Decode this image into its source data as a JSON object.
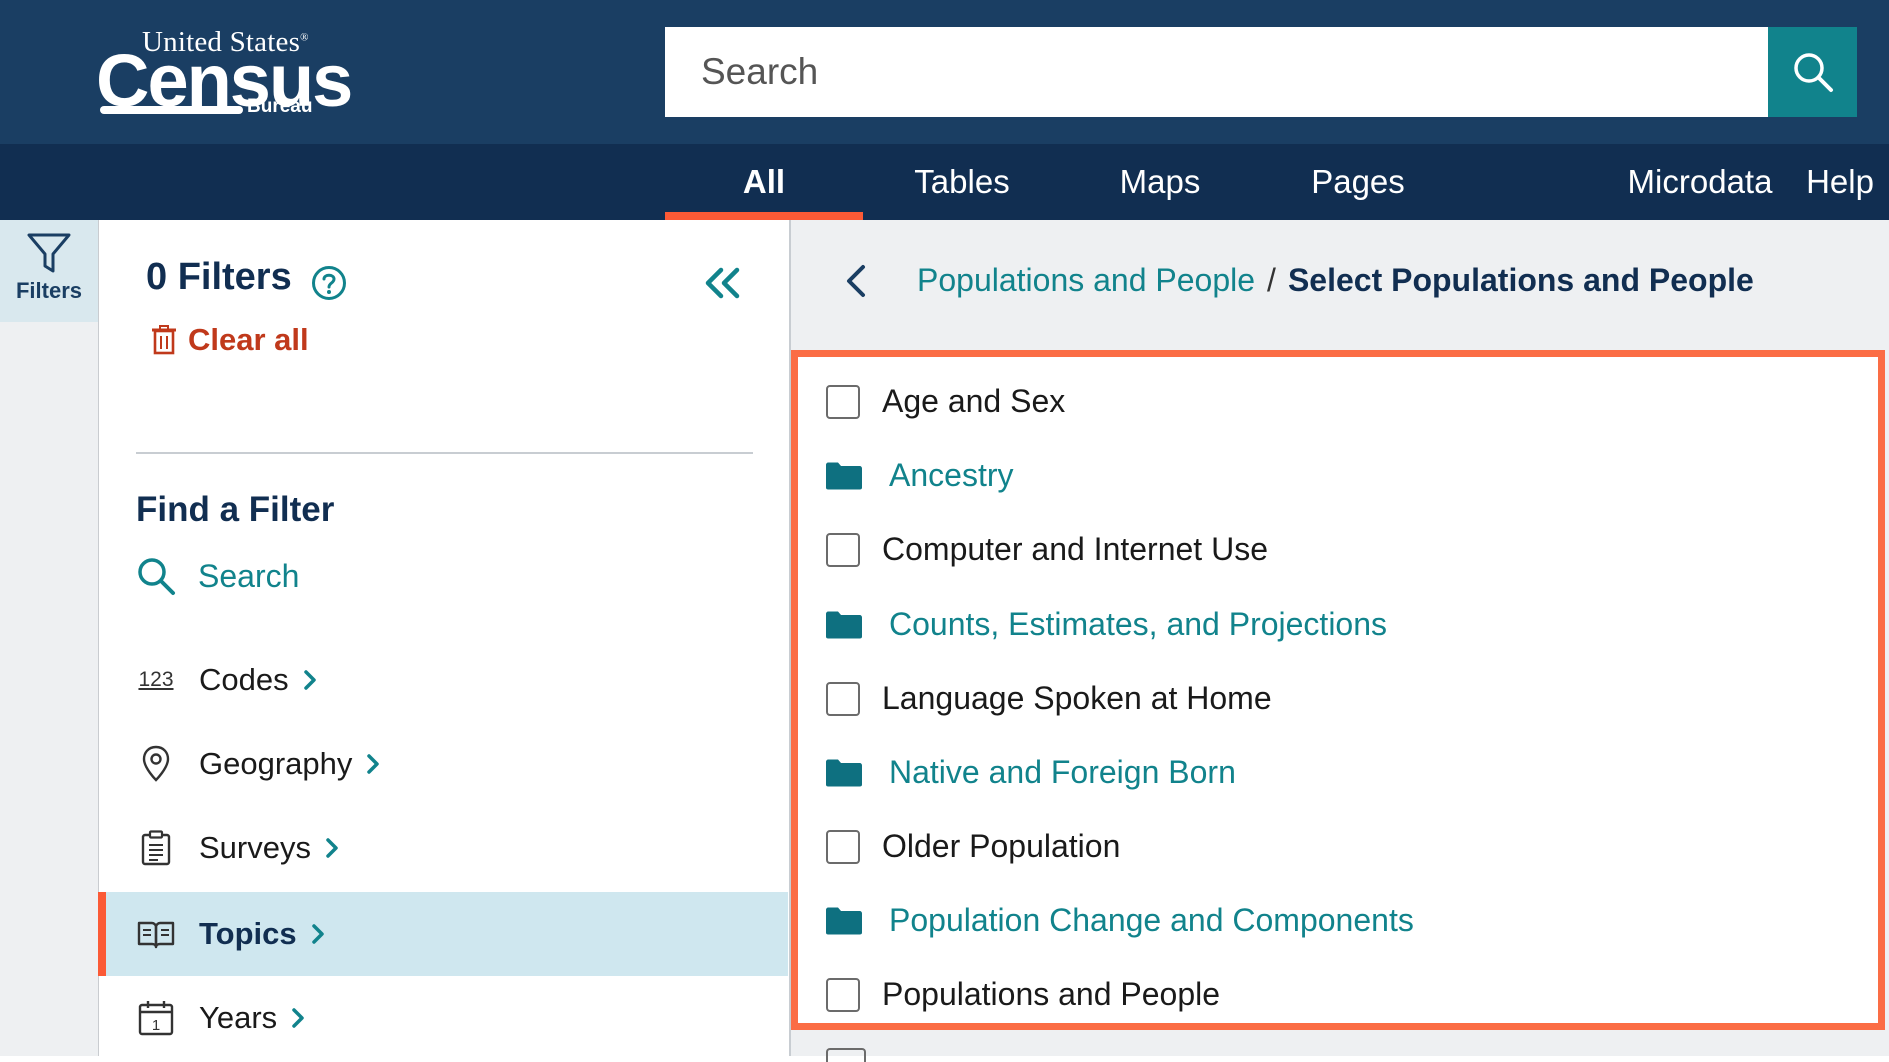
{
  "header": {
    "logo": {
      "line1": "United States",
      "reg": "®",
      "line2": "Census",
      "line3": "Bureau"
    },
    "search": {
      "placeholder": "Search"
    }
  },
  "tabs": [
    {
      "label": "All",
      "active": true
    },
    {
      "label": "Tables"
    },
    {
      "label": "Maps"
    },
    {
      "label": "Pages"
    },
    {
      "label": "Microdata"
    },
    {
      "label": "Help"
    }
  ],
  "rail": {
    "filters_label": "Filters"
  },
  "filter_panel": {
    "title": "0 Filters",
    "clear_label": "Clear all",
    "find_title": "Find a Filter",
    "search_label": "Search",
    "items": [
      {
        "icon": "codes-icon",
        "icon_text": "123",
        "label": "Codes"
      },
      {
        "icon": "location-pin-icon",
        "label": "Geography"
      },
      {
        "icon": "clipboard-icon",
        "label": "Surveys"
      },
      {
        "icon": "open-book-icon",
        "label": "Topics",
        "active": true
      },
      {
        "icon": "calendar-icon",
        "icon_text": "1",
        "label": "Years"
      }
    ]
  },
  "breadcrumb": {
    "parent": "Populations and People",
    "separator": "/",
    "current": "Select Populations and People"
  },
  "topics": [
    {
      "label": "Age and Sex",
      "type": "checkbox"
    },
    {
      "label": "Ancestry",
      "type": "folder"
    },
    {
      "label": "Computer and Internet Use",
      "type": "checkbox"
    },
    {
      "label": "Counts, Estimates, and Projections",
      "type": "folder"
    },
    {
      "label": "Language Spoken at Home",
      "type": "checkbox"
    },
    {
      "label": "Native and Foreign Born",
      "type": "folder"
    },
    {
      "label": "Older Population",
      "type": "checkbox"
    },
    {
      "label": "Population Change and Components",
      "type": "folder"
    },
    {
      "label": "Populations and People",
      "type": "checkbox"
    }
  ],
  "colors": {
    "navy": "#1a3e63",
    "dark_navy": "#112e51",
    "teal": "#11838c",
    "accent": "#fb5a36",
    "clear_red": "#c0391b",
    "active_bg": "#cfe7ef"
  }
}
